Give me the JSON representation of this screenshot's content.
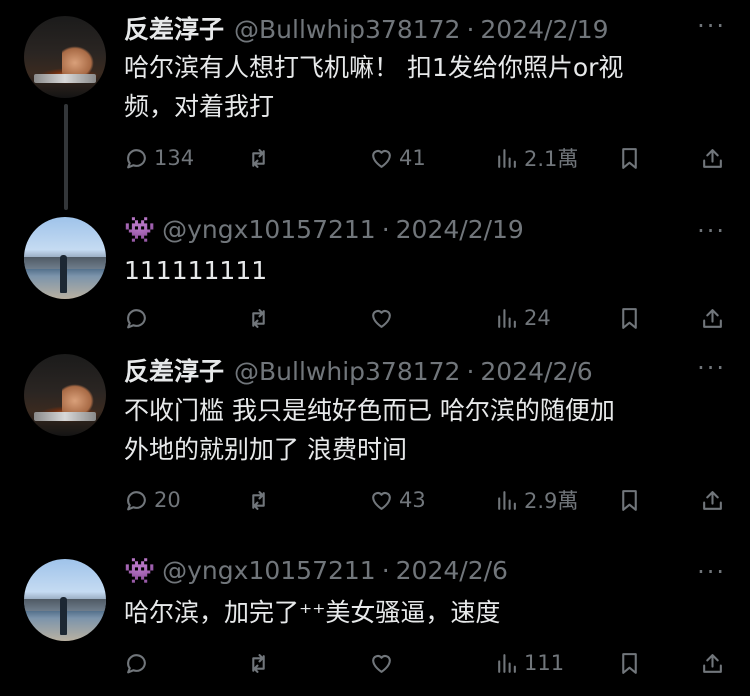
{
  "tweets": [
    {
      "name": "反差淳子",
      "handle": "@Bullwhip378172",
      "date": "2024/2/19",
      "text": [
        "哈尔滨有人想打飞机嘛！ 扣1发给你照片or视",
        "频，对着我打"
      ],
      "replies": "134",
      "retweets": "",
      "likes": "41",
      "views": "2.1萬"
    },
    {
      "name": "👾",
      "handle": "@yngx10157211",
      "date": "2024/2/19",
      "text": [
        "111111111"
      ],
      "replies": "",
      "retweets": "",
      "likes": "",
      "views": "24"
    },
    {
      "name": "反差淳子",
      "handle": "@Bullwhip378172",
      "date": "2024/2/6",
      "text": [
        "不收门槛 我只是纯好色而已  哈尔滨的随便加",
        "外地的就别加了 浪费时间"
      ],
      "replies": "20",
      "retweets": "",
      "likes": "43",
      "views": "2.9萬"
    },
    {
      "name": "👾",
      "handle": "@yngx10157211",
      "date": "2024/2/6",
      "text": [
        "哈尔滨，加完了⁺⁺美女骚逼，速度"
      ],
      "replies": "",
      "retweets": "",
      "likes": "",
      "views": "111"
    }
  ],
  "separator": "·",
  "more_glyph": "···"
}
